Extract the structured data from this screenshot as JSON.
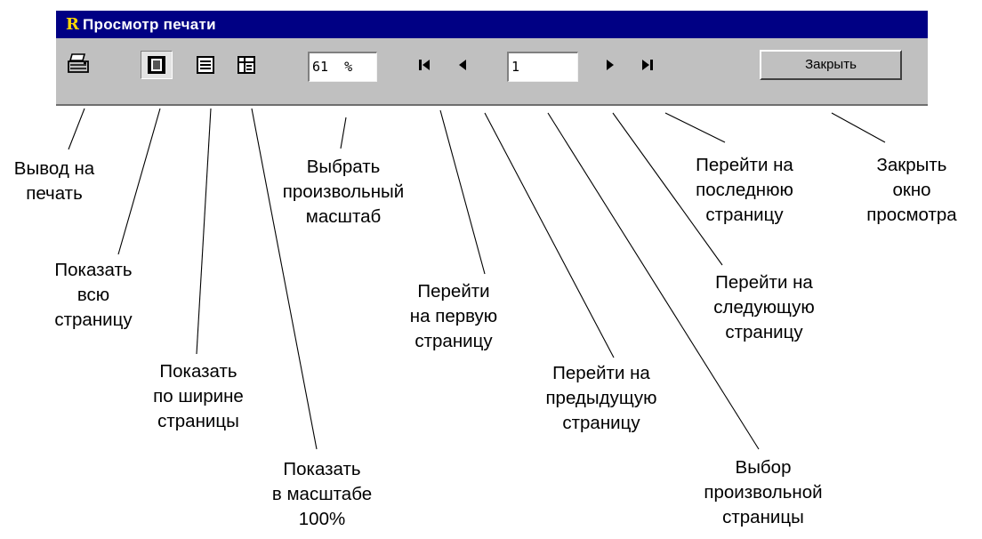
{
  "window": {
    "app_icon": "R",
    "title": "Просмотр печати"
  },
  "toolbar": {
    "print_icon": "printer-icon",
    "zoom_value": "61",
    "zoom_unit": "%",
    "page_value": "1",
    "close_label": "Закрыть"
  },
  "labels": {
    "print": "Вывод на\nпечать",
    "whole_page": "Показать\nвсю\nстраницу",
    "page_width": "Показать\nпо ширине\nстраницы",
    "scale_100": "Показать\nв масштабе\n100%",
    "custom_scale": "Выбрать\nпроизвольный\nмасштаб",
    "first_page": "Перейти\nна первую\nстраницу",
    "prev_page": "Перейти на\nпредыдущую\nстраницу",
    "choose_page": "Выбор\nпроизвольной\nстраницы",
    "next_page": "Перейти на\nследующую\nстраницу",
    "last_page": "Перейти на\nпоследнюю\nстраницу",
    "close_window": "Закрыть\nокно\nпросмотра"
  },
  "colors": {
    "titlebar": "#000084",
    "face": "#c0c0c0",
    "app_icon": "#ffd800"
  }
}
